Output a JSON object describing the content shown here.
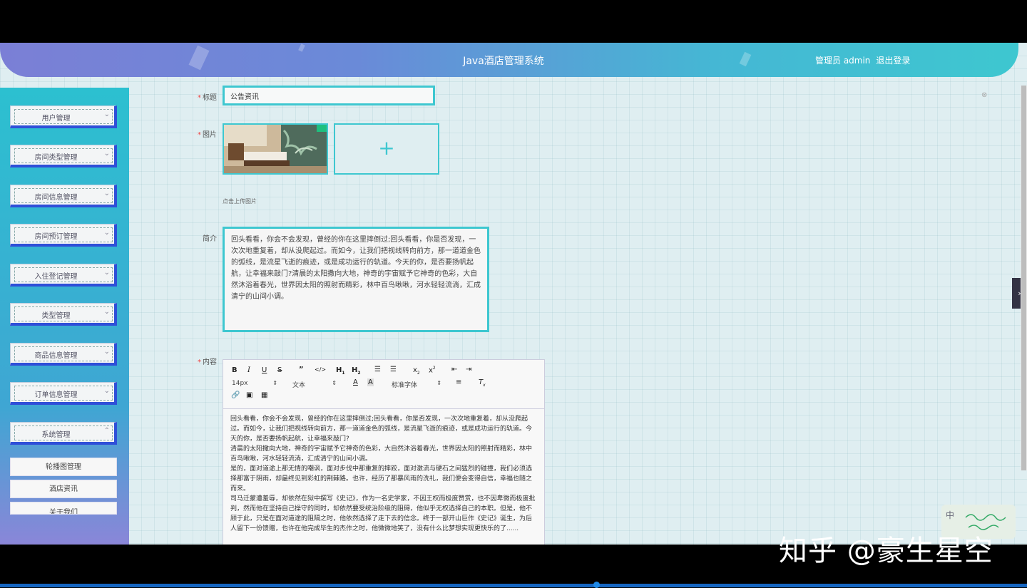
{
  "header": {
    "title": "Java酒店管理系统",
    "user_text": "管理员 admin",
    "logout": "退出登录"
  },
  "sidebar": {
    "menus": [
      {
        "label": "用户管理",
        "chevron": "chevron-down-icon"
      },
      {
        "label": "房间类型管理",
        "chevron": "chevron-down-icon"
      },
      {
        "label": "房间信息管理",
        "chevron": "chevron-down-icon"
      },
      {
        "label": "房间预订管理",
        "chevron": "chevron-down-icon"
      },
      {
        "label": "入住登记管理",
        "chevron": "chevron-down-icon"
      },
      {
        "label": "类型管理",
        "chevron": "chevron-down-icon"
      },
      {
        "label": "商品信息管理",
        "chevron": "chevron-down-icon"
      },
      {
        "label": "订单信息管理",
        "chevron": "chevron-down-icon"
      },
      {
        "label": "系统管理",
        "chevron": "chevron-up-icon"
      }
    ],
    "submenu": [
      {
        "label": "轮播图管理"
      },
      {
        "label": "酒店资讯"
      },
      {
        "label": "关于我们"
      }
    ]
  },
  "form": {
    "title_label": "标题",
    "title_value": "公告资讯",
    "image_label": "图片",
    "upload_tip": "点击上传图片",
    "intro_label": "简介",
    "intro_value": "回头看看，你会不会发现，曾经的你在这里摔倒过;回头看看，你是否发现，一次次地重复着，却从没爬起过。而如今，让我们把视线转向前方，那一道道金色的弧线，是流星飞逝的痕迹，或是成功运行的轨道。今天的你，是否要扬帆起航，让幸福来敲门?清晨的太阳撒向大地，神奇的宇宙赋予它神奇的色彩，大自然沐浴着春光，世界因太阳的照射而精彩，林中百鸟啾啾，河水轻轻流淌，汇成清宁的山间小调。",
    "content_label": "内容"
  },
  "editor": {
    "font_size": "14px",
    "text_type": "文本",
    "font_family": "标准字体",
    "paragraphs": [
      "回头看看，你会不会发现，曾经的你在这里摔倒过;回头看看，你是否发现，一次次地重复着，却从没爬起过。而如今，让我们把视线转向前方，那一道道金色的弧线，是流星飞逝的痕迹，或是成功运行的轨道。今天的你，是否要扬帆起航，让幸福来敲门?",
      "清晨的太阳撒向大地，神奇的宇宙赋予它神奇的色彩，大自然沐浴着春光，世界因太阳的照射而精彩，林中百鸟啾啾，河水轻轻流淌，汇成清宁的山间小调。",
      "是的，面对道途上那无情的嘲讽，面对步伐中那重复的摔跤，面对激流与硬石之间猛烈的碰撞，我们必须选择那富于阴雨，却最终见到彩虹的荆棘路。也许，经历了那暴风雨的洗礼，我们便会变得自信，幸福也随之而来。",
      "司马迁蒙遭羞辱，却依然在狱中撰写《史记》，作为一名史学家，不因王权而极度赞赏，也不因卑微而极度批判，然而他在坚持自己操守的同时，却依然要受统治阶级的阻碍，他似乎无权选择自己的本职。但是，他不顾于此，只是在面对道途的阻隔之时，他依然选择了走下去的信念。终于一部开山巨作《史记》诞生，为后人留下一份馈赠，也许在他完成毕生的杰作之时，他微微地笑了，没有什么比梦想实现更快乐的了......"
    ]
  },
  "widget": {
    "label": "中"
  },
  "watermark": "知乎 @豪生星空"
}
